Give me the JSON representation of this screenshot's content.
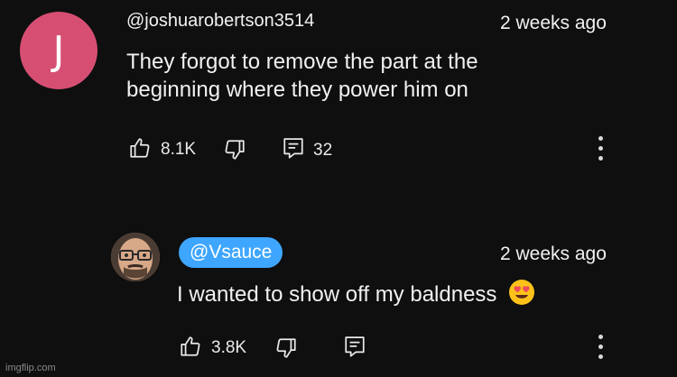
{
  "comment": {
    "avatar_letter": "J",
    "username": "@joshuarobertson3514",
    "time": "2 weeks ago",
    "text_line1": "They forgot to remove the part at the",
    "text_line2": "beginning where they power him on",
    "likes": "8.1K",
    "replies": "32"
  },
  "reply": {
    "username": "@Vsauce",
    "time": "2 weeks ago",
    "text": "I wanted to show off my baldness",
    "emoji": "heart-eyes-emoji",
    "likes": "3.8K"
  },
  "colors": {
    "background": "#0f0f0f",
    "avatar_j": "#d64f73",
    "creator_chip": "#3ea6ff",
    "text": "#f1f1f1"
  },
  "icons": [
    "like-icon",
    "dislike-icon",
    "reply-icon",
    "more-options-icon"
  ],
  "watermark": "imgflip.com"
}
